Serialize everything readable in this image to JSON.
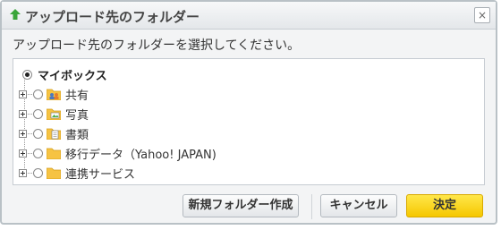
{
  "dialog": {
    "title": "アップロード先のフォルダー",
    "close_symbol": "×",
    "instruction": "アップロード先のフォルダーを選択してください。"
  },
  "tree": {
    "root": {
      "label": "マイボックス",
      "selected": true
    },
    "items": [
      {
        "label": "共有",
        "icon": "shared-folder-icon"
      },
      {
        "label": "写真",
        "icon": "photo-folder-icon"
      },
      {
        "label": "書類",
        "icon": "document-folder-icon"
      },
      {
        "label": "移行データ（Yahoo! JAPAN)",
        "icon": "folder-icon"
      },
      {
        "label": "連携サービス",
        "icon": "folder-icon"
      }
    ]
  },
  "buttons": {
    "new_folder": "新規フォルダー作成",
    "cancel": "キャンセル",
    "ok": "決定"
  },
  "colors": {
    "accent": "#f5c700",
    "title_arrow": "#3aa53a",
    "folder": "#f6c343"
  }
}
